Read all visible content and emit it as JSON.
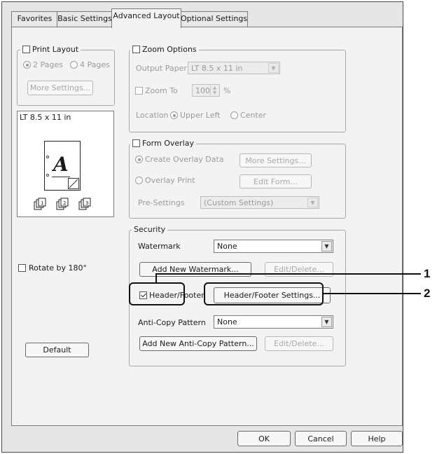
{
  "tabs": [
    "Favorites",
    "Basic Settings",
    "Advanced Layout",
    "Optional Settings"
  ],
  "print_layout": {
    "label": "Print Layout",
    "options": [
      "2 Pages",
      "4 Pages"
    ],
    "more_settings": "More Settings..."
  },
  "preview": {
    "paper_label": "LT 8.5 x 11 in",
    "page_letter": "A"
  },
  "rotate_label": "Rotate by 180°",
  "default_button": "Default",
  "zoom": {
    "label": "Zoom Options",
    "output_paper_label": "Output Paper",
    "output_paper_value": "LT 8.5 x 11 in",
    "zoom_to_label": "Zoom To",
    "zoom_value": "100",
    "percent": "%",
    "location_label": "Location",
    "location_options": [
      "Upper Left",
      "Center"
    ]
  },
  "form_overlay": {
    "label": "Form Overlay",
    "create_label": "Create Overlay Data",
    "more_settings": "More Settings...",
    "overlay_print_label": "Overlay Print",
    "edit_form": "Edit Form...",
    "presettings_label": "Pre-Settings",
    "presettings_value": "(Custom Settings)"
  },
  "security": {
    "label": "Security",
    "watermark_label": "Watermark",
    "watermark_value": "None",
    "add_watermark": "Add New Watermark...",
    "edit_delete": "Edit/Delete...",
    "header_footer_label": "Header/Footer",
    "header_footer_settings": "Header/Footer Settings...",
    "anticopy_label": "Anti-Copy Pattern",
    "anticopy_value": "None",
    "add_anticopy": "Add New Anti-Copy Pattern...",
    "edit_delete2": "Edit/Delete..."
  },
  "dialog_buttons": {
    "ok": "OK",
    "cancel": "Cancel",
    "help": "Help"
  },
  "callouts": {
    "one": "1",
    "two": "2"
  }
}
